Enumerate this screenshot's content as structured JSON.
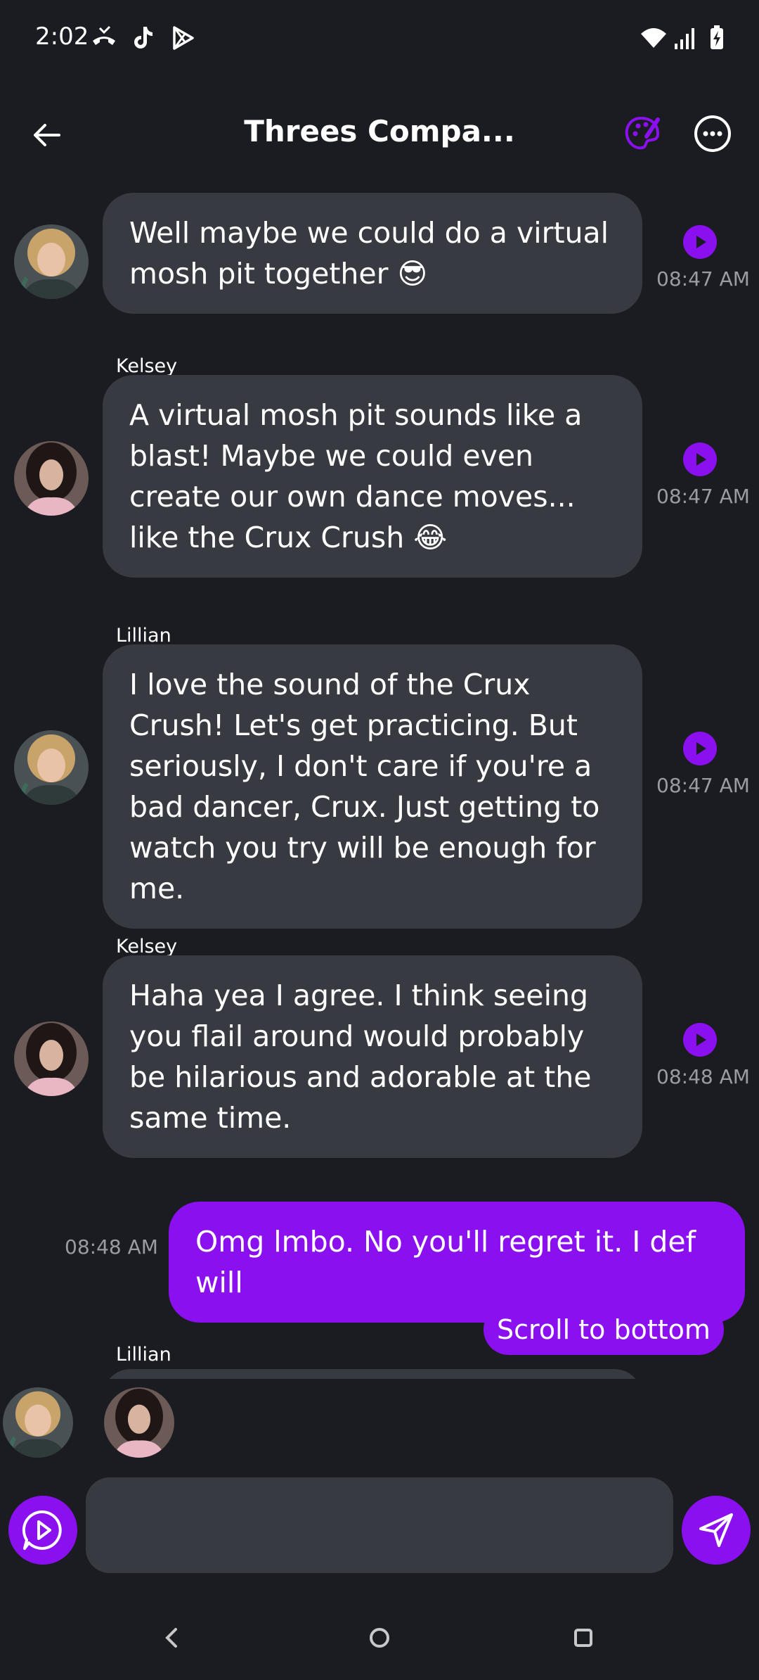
{
  "status_bar": {
    "time": "2:02",
    "icons": [
      "missed-call-icon",
      "tiktok-icon",
      "play-store-icon",
      "wifi-icon",
      "signal-icon",
      "battery-charging-icon"
    ]
  },
  "header": {
    "title": "Threes Compa...",
    "back_icon": "arrow-left-icon",
    "palette_icon": "palette-icon",
    "more_icon": "more-horizontal-icon",
    "accent_color": "#8a10f0"
  },
  "messages": [
    {
      "sender": "",
      "text": "Well maybe we could do a virtual mosh pit together 😎",
      "time": "08:47 AM",
      "avatar": "avatar-tattooed-blonde"
    },
    {
      "sender": "Kelsey",
      "text": "A virtual mosh pit sounds like a blast! Maybe we could even create our own dance moves... like the Crux Crush 😂",
      "time": "08:47 AM",
      "avatar": "avatar-dark-hair"
    },
    {
      "sender": "Lillian",
      "text": "I love the sound of the Crux Crush! Let's get practicing. But seriously, I don't care if you're a bad dancer, Crux. Just getting to watch you try will be enough for me.",
      "time": "08:47 AM",
      "avatar": "avatar-tattooed-blonde"
    },
    {
      "sender": "Kelsey",
      "text": "Haha yea I agree. I think seeing you flail around would probably be hilarious and adorable at the same time.",
      "time": "08:48 AM",
      "avatar": "avatar-dark-hair"
    }
  ],
  "outgoing": {
    "text": "Omg lmbo. No you'll regret it. I def will",
    "time": "08:48 AM"
  },
  "next_sender": "Lillian",
  "scroll_button": "Scroll to bottom",
  "composer": {
    "placeholder": "",
    "voice_icon": "voice-play-icon",
    "send_icon": "send-icon"
  },
  "nav": {
    "back": "nav-back-icon",
    "home": "nav-home-icon",
    "recents": "nav-recents-icon"
  }
}
